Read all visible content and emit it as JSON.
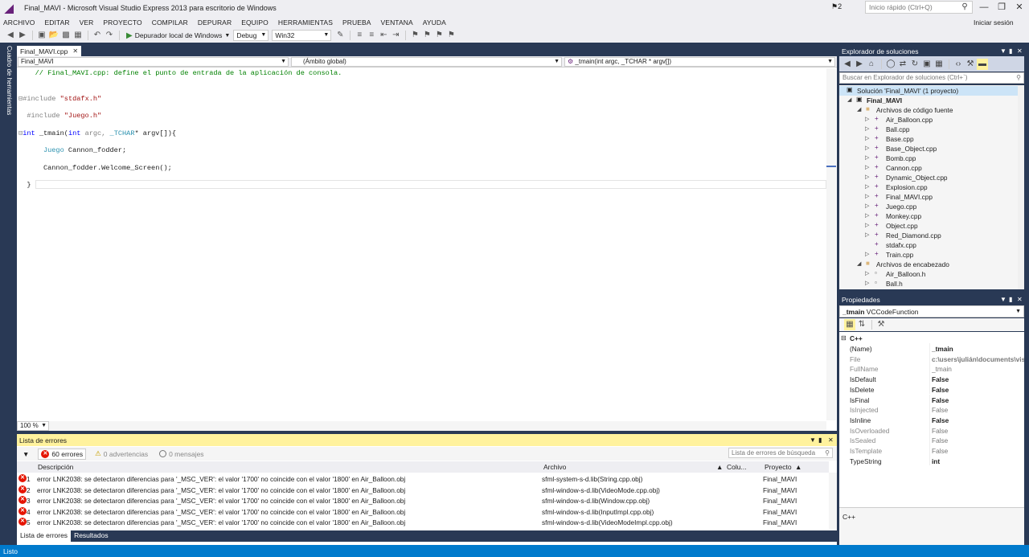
{
  "window": {
    "title": "Final_MAVI - Microsoft Visual Studio Express 2013 para escritorio de Windows",
    "notifications": "2",
    "quick_launch_placeholder": "Inicio rápido (Ctrl+Q)",
    "sign_in": "Iniciar sesión"
  },
  "menu": [
    "ARCHIVO",
    "EDITAR",
    "VER",
    "PROYECTO",
    "COMPILAR",
    "DEPURAR",
    "EQUIPO",
    "HERRAMIENTAS",
    "PRUEBA",
    "VENTANA",
    "AYUDA"
  ],
  "toolbar": {
    "debugger": "Depurador local de Windows",
    "config": "Debug",
    "platform": "Win32"
  },
  "left_rail": {
    "label": "Cuadro de herramientas"
  },
  "editor": {
    "tab": "Final_MAVI.cpp",
    "nav_project": "Final_MAVI",
    "nav_scope": "(Ámbito global)",
    "nav_member": "_tmain(int argc, _TCHAR * argv[])",
    "zoom": "100 %",
    "code": {
      "comment": "// Final_MAVI.cpp: define el punto de entrada de la aplicación de consola.",
      "inc1_kw": "#include",
      "inc1_file": "\"stdafx.h\"",
      "inc2_kw": "#include",
      "inc2_file": "\"Juego.h\"",
      "main_kw": "int",
      "main_name": " _tmain(",
      "main_kw2": "int",
      "main_p1": " argc, ",
      "main_type": "_TCHAR",
      "main_p2": "* argv[]){",
      "decl_type": "Juego",
      "decl_rest": " Cannon_fodder;",
      "call": "Cannon_fodder.Welcome_Screen();",
      "close": "}"
    }
  },
  "error_list": {
    "title": "Lista de errores",
    "errors_filter": "60 errores",
    "warnings_filter": "0 advertencias",
    "messages_filter": "0 mensajes",
    "search_placeholder": "Lista de errores de búsqueda",
    "columns": {
      "description": "Descripción",
      "file": "Archivo",
      "column": "Colu...",
      "project": "Proyecto"
    },
    "rows": [
      {
        "n": "1",
        "description": "error LNK2038: se detectaron diferencias para '_MSC_VER': el valor '1700' no coincide con el valor '1800' en Air_Balloon.obj",
        "file": "sfml-system-s-d.lib(String.cpp.obj)",
        "project": "Final_MAVI"
      },
      {
        "n": "2",
        "description": "error LNK2038: se detectaron diferencias para '_MSC_VER': el valor '1700' no coincide con el valor '1800' en Air_Balloon.obj",
        "file": "sfml-window-s-d.lib(VideoMode.cpp.obj)",
        "project": "Final_MAVI"
      },
      {
        "n": "3",
        "description": "error LNK2038: se detectaron diferencias para '_MSC_VER': el valor '1700' no coincide con el valor '1800' en Air_Balloon.obj",
        "file": "sfml-window-s-d.lib(Window.cpp.obj)",
        "project": "Final_MAVI"
      },
      {
        "n": "4",
        "description": "error LNK2038: se detectaron diferencias para '_MSC_VER': el valor '1700' no coincide con el valor '1800' en Air_Balloon.obj",
        "file": "sfml-window-s-d.lib(InputImpl.cpp.obj)",
        "project": "Final_MAVI"
      },
      {
        "n": "5",
        "description": "error LNK2038: se detectaron diferencias para '_MSC_VER': el valor '1700' no coincide con el valor '1800' en Air_Balloon.obj",
        "file": "sfml-window-s-d.lib(VideoModeImpl.cpp.obj)",
        "project": "Final_MAVI"
      }
    ],
    "tabs": [
      "Lista de errores",
      "Resultados"
    ]
  },
  "solution_explorer": {
    "title": "Explorador de soluciones",
    "search_placeholder": "Buscar en Explorador de soluciones (Ctrl+`)",
    "solution": "Solución 'Final_MAVI' (1 proyecto)",
    "project": "Final_MAVI",
    "source_folder": "Archivos de código fuente",
    "source_files": [
      "Air_Balloon.cpp",
      "Ball.cpp",
      "Base.cpp",
      "Base_Object.cpp",
      "Bomb.cpp",
      "Cannon.cpp",
      "Dynamic_Object.cpp",
      "Explosion.cpp",
      "Final_MAVI.cpp",
      "Juego.cpp",
      "Monkey.cpp",
      "Object.cpp",
      "Red_Diamond.cpp",
      "stdafx.cpp",
      "Train.cpp"
    ],
    "header_folder": "Archivos de encabezado",
    "header_files": [
      "Air_Balloon.h",
      "Ball.h"
    ]
  },
  "properties": {
    "title": "Propiedades",
    "object_name": "_tmain",
    "object_type": "VCCodeFunction",
    "category": "C++",
    "rows": [
      {
        "name": "(Name)",
        "value": "_tmain",
        "bold": true,
        "gray": false
      },
      {
        "name": "File",
        "value": "c:\\users\\julián\\documents\\visual",
        "bold": true,
        "gray": true
      },
      {
        "name": "FullName",
        "value": "_tmain",
        "bold": false,
        "gray": true
      },
      {
        "name": "IsDefault",
        "value": "False",
        "bold": true,
        "gray": false
      },
      {
        "name": "IsDelete",
        "value": "False",
        "bold": true,
        "gray": false
      },
      {
        "name": "IsFinal",
        "value": "False",
        "bold": true,
        "gray": false
      },
      {
        "name": "IsInjected",
        "value": "False",
        "bold": false,
        "gray": true
      },
      {
        "name": "IsInline",
        "value": "False",
        "bold": true,
        "gray": false
      },
      {
        "name": "IsOverloaded",
        "value": "False",
        "bold": false,
        "gray": true
      },
      {
        "name": "IsSealed",
        "value": "False",
        "bold": false,
        "gray": true
      },
      {
        "name": "IsTemplate",
        "value": "False",
        "bold": false,
        "gray": true
      },
      {
        "name": "TypeString",
        "value": "int",
        "bold": true,
        "gray": false
      }
    ],
    "description": "C++"
  },
  "status": {
    "text": "Listo"
  },
  "colors": {
    "accent": "#007acc",
    "panel_header": "#293955",
    "active_tab": "#fff29d",
    "error": "#e51400"
  }
}
